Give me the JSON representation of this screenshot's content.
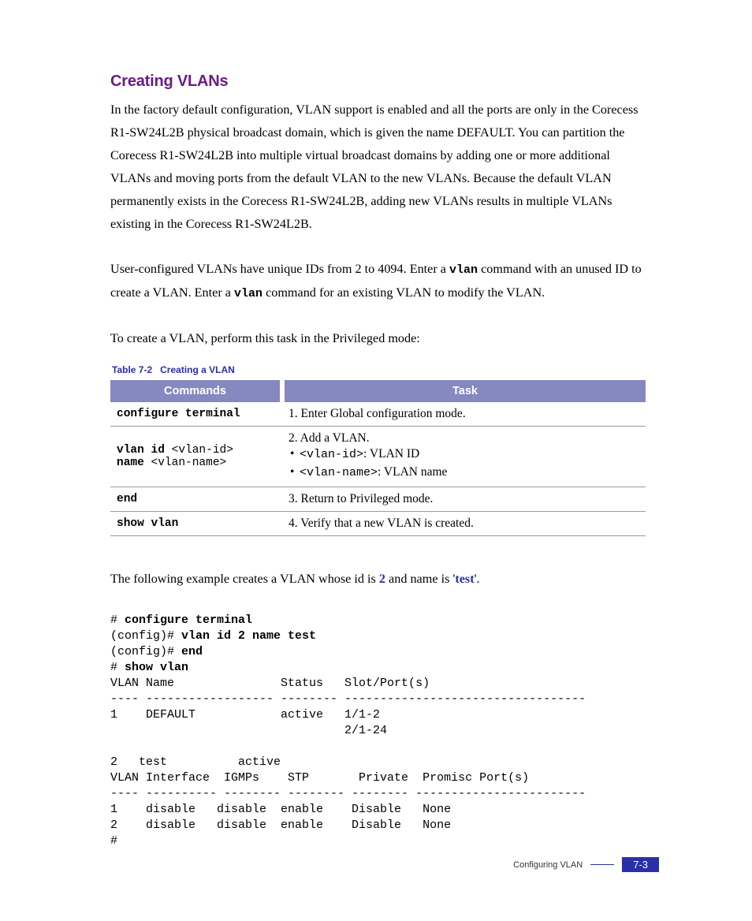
{
  "heading": "Creating VLANs",
  "para1": "In the factory default configuration, VLAN support is enabled and all the ports are only in the Corecess R1-SW24L2B physical broadcast domain, which is given the name DEFAULT. You can partition the Corecess R1-SW24L2B into multiple virtual broadcast domains by adding one or more additional VLANs and moving ports from the default VLAN to the new VLANs. Because the default VLAN permanently exists in the Corecess R1-SW24L2B, adding new VLANs results in multiple VLANs existing in the Corecess R1-SW24L2B.",
  "para2_a": "User-configured VLANs have unique IDs from 2 to 4094. Enter a ",
  "para2_code1": "vlan",
  "para2_b": " command with an unused ID to create a VLAN. Enter a ",
  "para2_code2": "vlan",
  "para2_c": " command for an existing VLAN to modify the VLAN.",
  "para3": "To create a VLAN, perform this task in the Privileged mode:",
  "table": {
    "caption_num": "Table 7-2",
    "caption_title": "Creating a VLAN",
    "col1": "Commands",
    "col2": "Task",
    "rows": [
      {
        "cmd_bold": "configure terminal",
        "cmd_param": "",
        "task_lead": "1. Enter Global configuration mode.",
        "bullets": []
      },
      {
        "cmd_bold": "vlan id",
        "cmd_param": " <vlan-id>",
        "cmd_bold2": "name",
        "cmd_param2": " <vlan-name>",
        "task_lead": "2. Add a VLAN.",
        "bullets": [
          {
            "mono": "<vlan-id>",
            "rest": ": VLAN ID"
          },
          {
            "mono": "<vlan-name>",
            "rest": ": VLAN name"
          }
        ]
      },
      {
        "cmd_bold": "end",
        "cmd_param": "",
        "task_lead": "3. Return to Privileged mode.",
        "bullets": []
      },
      {
        "cmd_bold": "show vlan",
        "cmd_param": "",
        "task_lead": "4. Verify that a new VLAN is created.",
        "bullets": []
      }
    ]
  },
  "example": {
    "lead_a": "The following example creates a VLAN whose id is ",
    "id_bold": "2",
    "lead_b": " and name is '",
    "name_bold": "test",
    "lead_c": "'.",
    "lines": [
      {
        "pre": "# ",
        "bold": "configure terminal",
        "post": ""
      },
      {
        "pre": "(config)# ",
        "bold": "vlan id 2 name test",
        "post": ""
      },
      {
        "pre": "(config)# ",
        "bold": "end",
        "post": ""
      },
      {
        "pre": "# ",
        "bold": "show vlan",
        "post": ""
      },
      {
        "pre": "VLAN Name               Status   Slot/Port(s)",
        "bold": "",
        "post": ""
      },
      {
        "pre": "---- ------------------ -------- ----------------------------------",
        "bold": "",
        "post": ""
      },
      {
        "pre": "1    DEFAULT            active   1/1-2",
        "bold": "",
        "post": ""
      },
      {
        "pre": "                                 2/1-24",
        "bold": "",
        "post": ""
      },
      {
        "pre": "",
        "bold": "",
        "post": ""
      },
      {
        "pre": "2   test          active",
        "bold": "",
        "post": ""
      },
      {
        "pre": "VLAN Interface  IGMPs    STP       Private  Promisc Port(s)",
        "bold": "",
        "post": ""
      },
      {
        "pre": "---- ---------- -------- -------- -------- ------------------------",
        "bold": "",
        "post": ""
      },
      {
        "pre": "1    disable   disable  enable    Disable   None",
        "bold": "",
        "post": ""
      },
      {
        "pre": "2    disable   disable  enable    Disable   None",
        "bold": "",
        "post": ""
      },
      {
        "pre": "#",
        "bold": "",
        "post": ""
      }
    ]
  },
  "footer": {
    "section": "Configuring VLAN",
    "page": "7-3"
  }
}
